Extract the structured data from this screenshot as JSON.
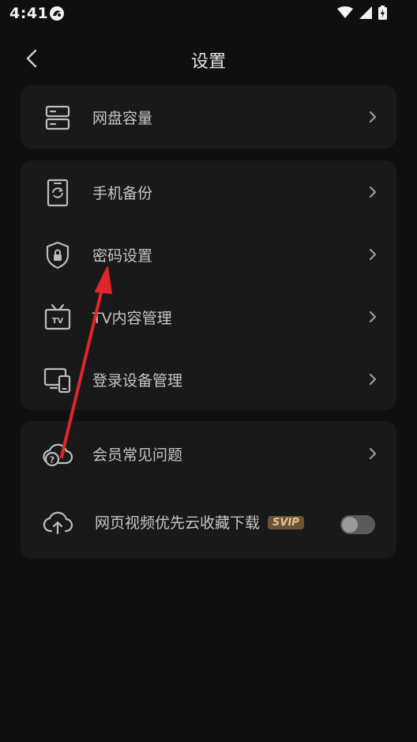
{
  "status_bar": {
    "time": "4:41"
  },
  "header": {
    "title": "设置"
  },
  "groups": [
    {
      "items": [
        {
          "label": "网盘容量",
          "icon": "server-storage-icon"
        }
      ]
    },
    {
      "items": [
        {
          "label": "手机备份",
          "icon": "phone-backup-icon"
        },
        {
          "label": "密码设置",
          "icon": "shield-lock-icon"
        },
        {
          "label": "TV内容管理",
          "icon": "tv-icon"
        },
        {
          "label": "登录设备管理",
          "icon": "devices-icon"
        }
      ]
    },
    {
      "items": [
        {
          "label": "会员常见问题",
          "icon": "cloud-question-icon"
        },
        {
          "label": "网页视频优先云收藏下载",
          "icon": "cloud-upload-icon",
          "badge": "SVIP",
          "toggle": {
            "on": false
          }
        }
      ]
    }
  ],
  "colors": {
    "background": "#0f0f0f",
    "card": "#191919",
    "label": "#c6c6c6",
    "icon": "#bdbdbd",
    "badge_bg": "#6b5436",
    "badge_text": "#e6c48e",
    "toggle_track": "#5a5a5a",
    "toggle_knob": "#9a9a9a",
    "annotation_arrow": "#e0262b"
  }
}
